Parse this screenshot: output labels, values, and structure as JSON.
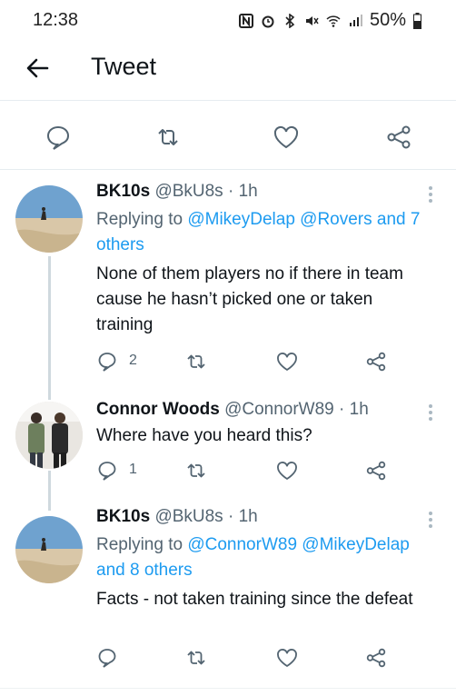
{
  "status_bar": {
    "time": "12:38",
    "battery": "50%"
  },
  "header": {
    "title": "Tweet"
  },
  "tweets": [
    {
      "name": "BK10s",
      "handle": "@BkU8s · 1h",
      "replying_prefix": "Replying to",
      "replying_to": "@MikeyDelap @Rovers and 7 others",
      "text": "None of them players no if there in team cause he hasn’t picked one or taken training",
      "reply_count": "2"
    },
    {
      "name": "Connor Woods",
      "handle": "@ConnorW89 · 1h",
      "text": "Where have you heard this?",
      "reply_count": "1"
    },
    {
      "name": "BK10s",
      "handle": "@BkU8s · 1h",
      "replying_prefix": "Replying to",
      "replying_to": "@ConnorW89 @MikeyDelap and 8 others",
      "text": "Facts - not taken training since the defeat",
      "reply_count": ""
    }
  ],
  "colors": {
    "link": "#1d9bf0",
    "icon": "#536471",
    "text": "#0f1419"
  }
}
